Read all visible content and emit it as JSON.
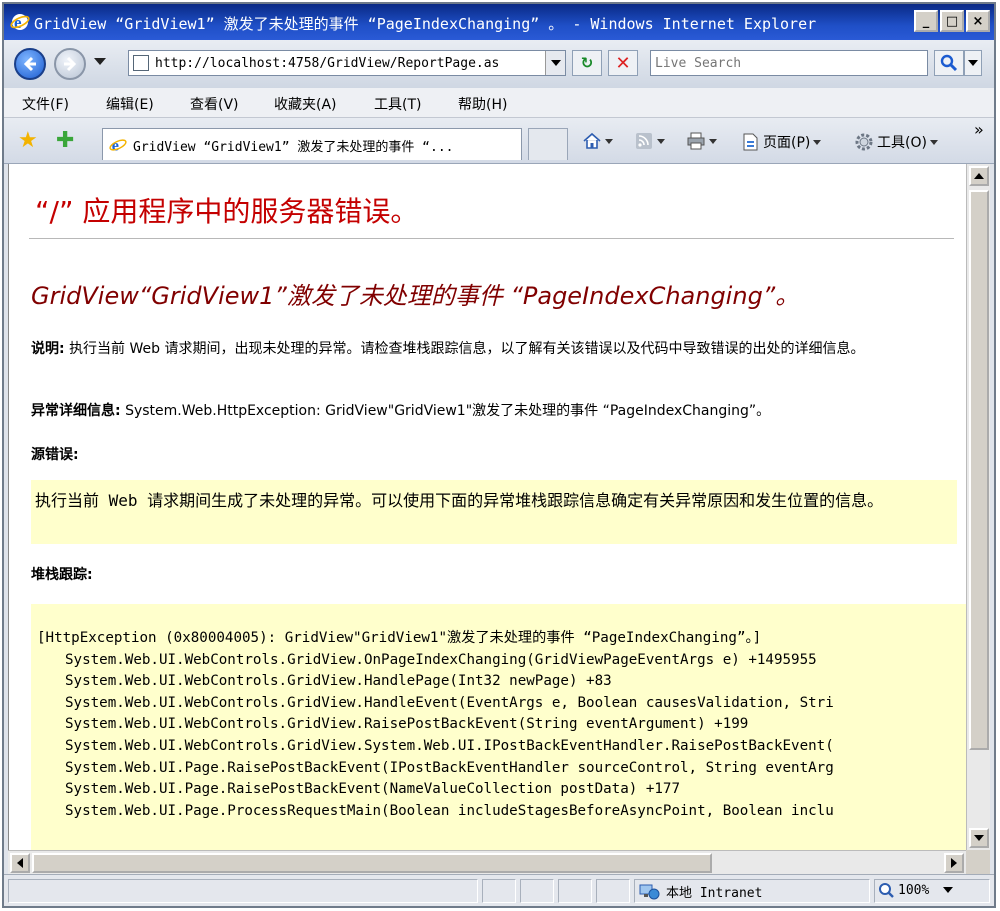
{
  "window": {
    "title": "GridView “GridView1” 激发了未处理的事件 “PageIndexChanging” 。 - Windows Internet Explorer",
    "min_glyph": "_",
    "max_glyph": "□",
    "close_glyph": "×"
  },
  "address": {
    "url": "http://localhost:4758/GridView/ReportPage.as",
    "refresh_glyph": "↻",
    "stop_glyph": "✕"
  },
  "search": {
    "placeholder": "Live Search",
    "go_glyph": "⌕"
  },
  "menu": [
    {
      "label": "文件(F)"
    },
    {
      "label": "编辑(E)"
    },
    {
      "label": "查看(V)"
    },
    {
      "label": "收藏夹(A)"
    },
    {
      "label": "工具(T)"
    },
    {
      "label": "帮助(H)"
    }
  ],
  "tabbar": {
    "favorites_glyph": "★",
    "add_fav_glyph": "✚",
    "tab_title": "GridView “GridView1” 激发了未处理的事件 “...",
    "page_label": "页面(P)",
    "tools_label": "工具(O)",
    "chevron": "»"
  },
  "content": {
    "heading": "“/” 应用程序中的服务器错误。",
    "error_title": "GridView“GridView1”激发了未处理的事件 “PageIndexChanging”。",
    "desc_label": "说明:",
    "desc_text": "执行当前 Web 请求期间，出现未处理的异常。请检查堆栈跟踪信息，以了解有关该错误以及代码中导致错误的出处的详细信息。",
    "exc_label": "异常详细信息:",
    "exc_text": "System.Web.HttpException: GridView\"GridView1\"激发了未处理的事件 “PageIndexChanging”。",
    "source_label": "源错误:",
    "source_text": "执行当前 Web 请求期间生成了未处理的异常。可以使用下面的异常堆栈跟踪信息确定有关异常原因和发生位置的信息。",
    "stack_label": "堆栈跟踪:",
    "stack_lines": [
      "[HttpException (0x80004005): GridView\"GridView1\"激发了未处理的事件 “PageIndexChanging”。]",
      "System.Web.UI.WebControls.GridView.OnPageIndexChanging(GridViewPageEventArgs e) +1495955",
      "System.Web.UI.WebControls.GridView.HandlePage(Int32 newPage) +83",
      "System.Web.UI.WebControls.GridView.HandleEvent(EventArgs e, Boolean causesValidation, Stri",
      "System.Web.UI.WebControls.GridView.RaisePostBackEvent(String eventArgument) +199",
      "System.Web.UI.WebControls.GridView.System.Web.UI.IPostBackEventHandler.RaisePostBackEvent(",
      "System.Web.UI.Page.RaisePostBackEvent(IPostBackEventHandler sourceControl, String eventArg",
      "System.Web.UI.Page.RaisePostBackEvent(NameValueCollection postData) +177",
      "System.Web.UI.Page.ProcessRequestMain(Boolean includeStagesBeforeAsyncPoint, Boolean inclu"
    ]
  },
  "status": {
    "zone": "本地 Intranet",
    "zoom": "100%"
  },
  "colors": {
    "heading": "#c40000",
    "error_title": "#800000",
    "box_bg": "#ffffcc"
  }
}
